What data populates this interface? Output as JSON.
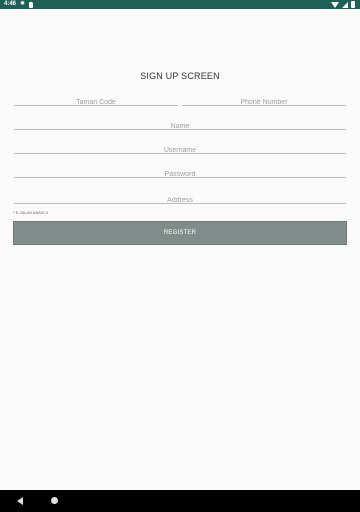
{
  "status_bar": {
    "time": "4:46"
  },
  "form": {
    "title": "SIGN UP SCREEN",
    "taman_code": {
      "placeholder": "Taman Code"
    },
    "phone_number": {
      "placeholder": "Phone Number"
    },
    "name": {
      "placeholder": "Name"
    },
    "username": {
      "placeholder": "Username"
    },
    "password": {
      "placeholder": "Password"
    },
    "address": {
      "placeholder": "Address"
    },
    "address_note": "* E.JALAN ABASI 3",
    "register_label": "REGISTER"
  },
  "colors": {
    "status_bar": "#1f5f55",
    "button": "#7f8c89",
    "background": "#fafafa",
    "nav_bar": "#000000"
  },
  "icons": {
    "status_left": [
      "gear-icon",
      "sd-card-icon"
    ],
    "status_right": [
      "wifi-icon",
      "signal-icon",
      "battery-icon"
    ],
    "nav": [
      "back-icon",
      "home-icon"
    ]
  }
}
